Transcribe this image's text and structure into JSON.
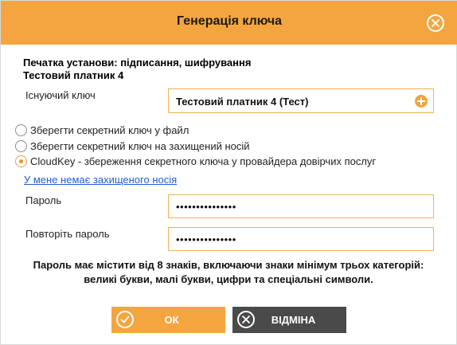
{
  "dialog": {
    "title": "Генерація ключа",
    "seal_line1": "Печатка установи: підписання, шифрування",
    "seal_line2": "Тестовий платник 4"
  },
  "form": {
    "existing_key_label": "Існуючий ключ",
    "existing_key_value": "Тестовий платник 4 (Тест)",
    "options": [
      {
        "label": "Зберегти секретний ключ у файл",
        "selected": false
      },
      {
        "label": "Зберегти секретний ключ на захищений носій",
        "selected": false
      },
      {
        "label": "CloudKey - збереження секретного ключа у провайдера довірчих послуг",
        "selected": true
      }
    ],
    "no_media_link": "У мене немає захищеного носія",
    "password_label": "Пароль",
    "password_value": "•••••••••••••••",
    "confirm_label": "Повторіть пароль",
    "confirm_value": "•••••••••••••••",
    "hint_line1": "Пароль має містити від 8 знаків, включаючи знаки мінімум трьох категорій:",
    "hint_line2": "великі букви, малі букви, цифри та спеціальні символи."
  },
  "buttons": {
    "ok_label": "ОК",
    "cancel_label": "ВІДМІНА"
  },
  "colors": {
    "accent": "#f4a540",
    "cancel_bg": "#4a4a4a",
    "link": "#1f5fd6"
  }
}
